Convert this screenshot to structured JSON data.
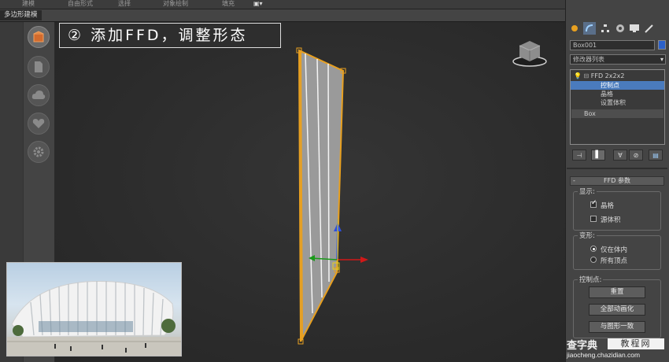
{
  "topbar": {
    "tabs": [
      "建模",
      "自由形式",
      "选择",
      "对象绘制",
      "填充"
    ]
  },
  "subbar": {
    "label": "多边形建模"
  },
  "left_toolbar": {
    "icons": [
      "teapot-icon",
      "document-icon",
      "cloud-icon",
      "heart-icon",
      "gear-icon"
    ]
  },
  "viewport": {
    "step_label": "② 添加FFD，调整形态"
  },
  "command_panel": {
    "object_name": "Box001",
    "modifier_list": "修改器列表",
    "stack": {
      "items": [
        {
          "label": "FFD 2x2x2",
          "selected": false
        },
        {
          "label": "控制点",
          "selected": true
        },
        {
          "label": "晶格",
          "selected": false
        },
        {
          "label": "设置体积",
          "selected": false
        },
        {
          "label": "Box",
          "selected": false
        }
      ]
    },
    "rollout": {
      "title": "FFD 参数",
      "display": {
        "title": "显示:",
        "lattice_label": "晶格",
        "lattice_checked": true,
        "source_volume_label": "源体积",
        "source_volume_checked": false
      },
      "deform": {
        "title": "变形:",
        "option1": "仅在体内",
        "option2": "所有顶点",
        "selected": "仅在体内"
      },
      "control_points": {
        "title": "控制点:",
        "reset": "重置",
        "animate_all": "全部动画化",
        "conform": "与图形一致"
      }
    }
  },
  "watermark": {
    "line1": "查字典",
    "line2": "教程网",
    "url": "jiaocheng.chazidian.com"
  },
  "colors": {
    "lattice": "#e8a020",
    "selection_blue": "#4a7bbd",
    "panel_bg": "#444444"
  }
}
